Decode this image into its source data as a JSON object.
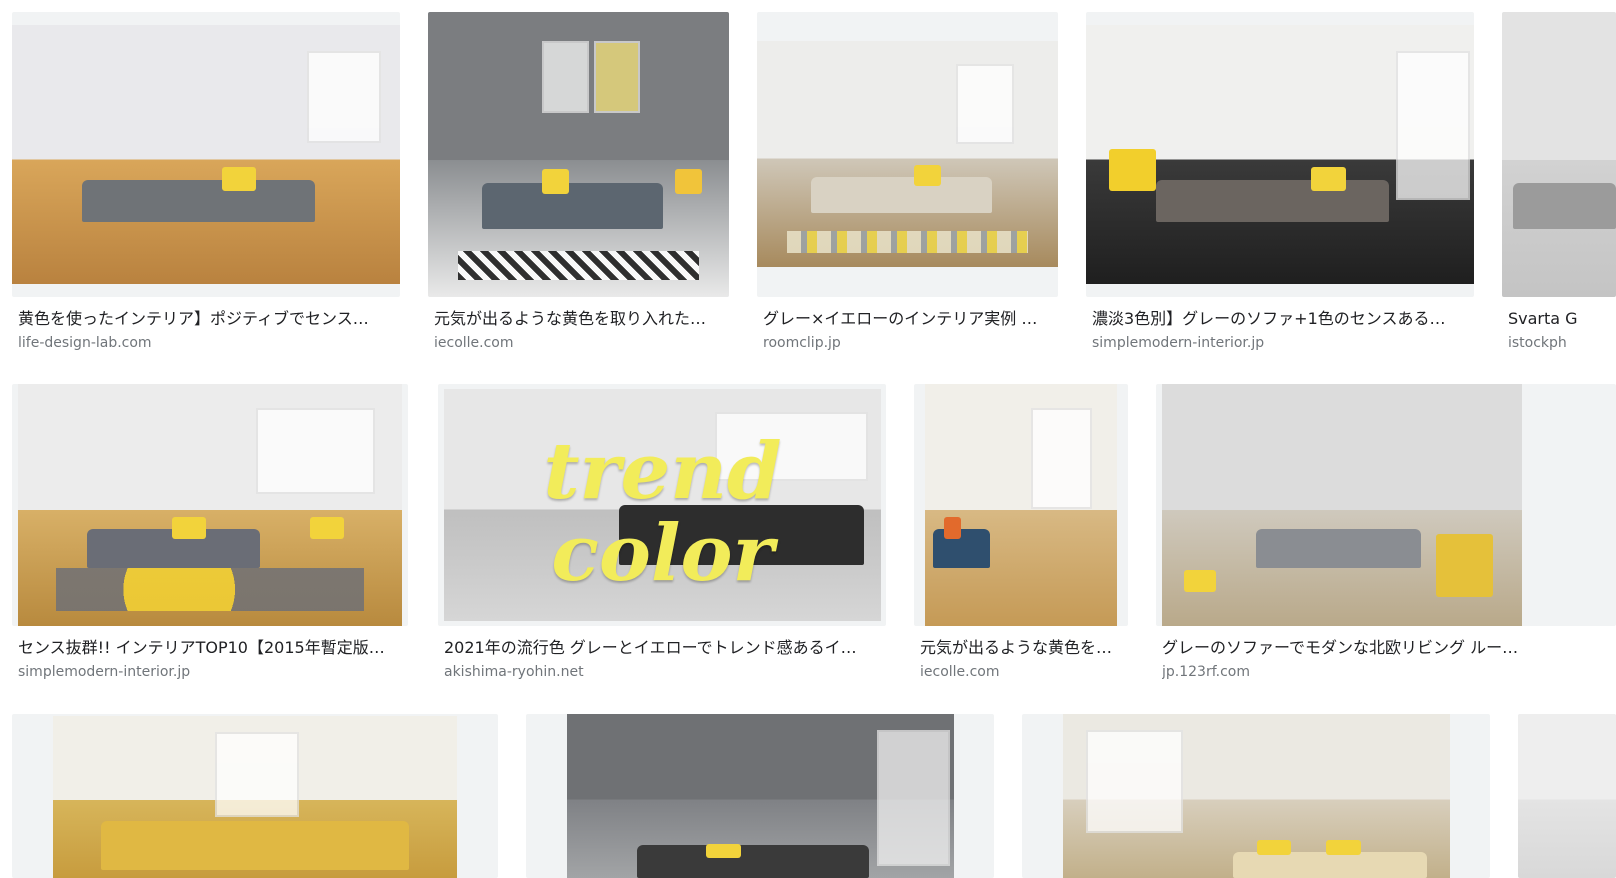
{
  "results": [
    {
      "title": "黄色を使ったインテリア】ポジティブでセンス…",
      "site": "life-design-lab.com"
    },
    {
      "title": "元気が出るような黄色を取り入れた…",
      "site": "iecolle.com"
    },
    {
      "title": "グレー×イエローのインテリア実例 …",
      "site": "roomclip.jp"
    },
    {
      "title": "濃淡3色別】グレーのソファ+1色のセンスある…",
      "site": "simplemodern-interior.jp"
    },
    {
      "title": "Svarta G",
      "site": "istockph"
    },
    {
      "title": "センス抜群!! インテリアTOP10【2015年暫定版…",
      "site": "simplemodern-interior.jp"
    },
    {
      "title": "2021年の流行色 グレーとイエローでトレンド感あるイ…",
      "site": "akishima-ryohin.net",
      "overlay": [
        "trend",
        "color"
      ]
    },
    {
      "title": "元気が出るような黄色を…",
      "site": "iecolle.com"
    },
    {
      "title": "グレーのソファーでモダンな北欧リビング ルー…",
      "site": "jp.123rf.com"
    },
    {
      "title": "",
      "site": ""
    },
    {
      "title": "",
      "site": ""
    },
    {
      "title": "",
      "site": ""
    },
    {
      "title": "",
      "site": ""
    }
  ]
}
